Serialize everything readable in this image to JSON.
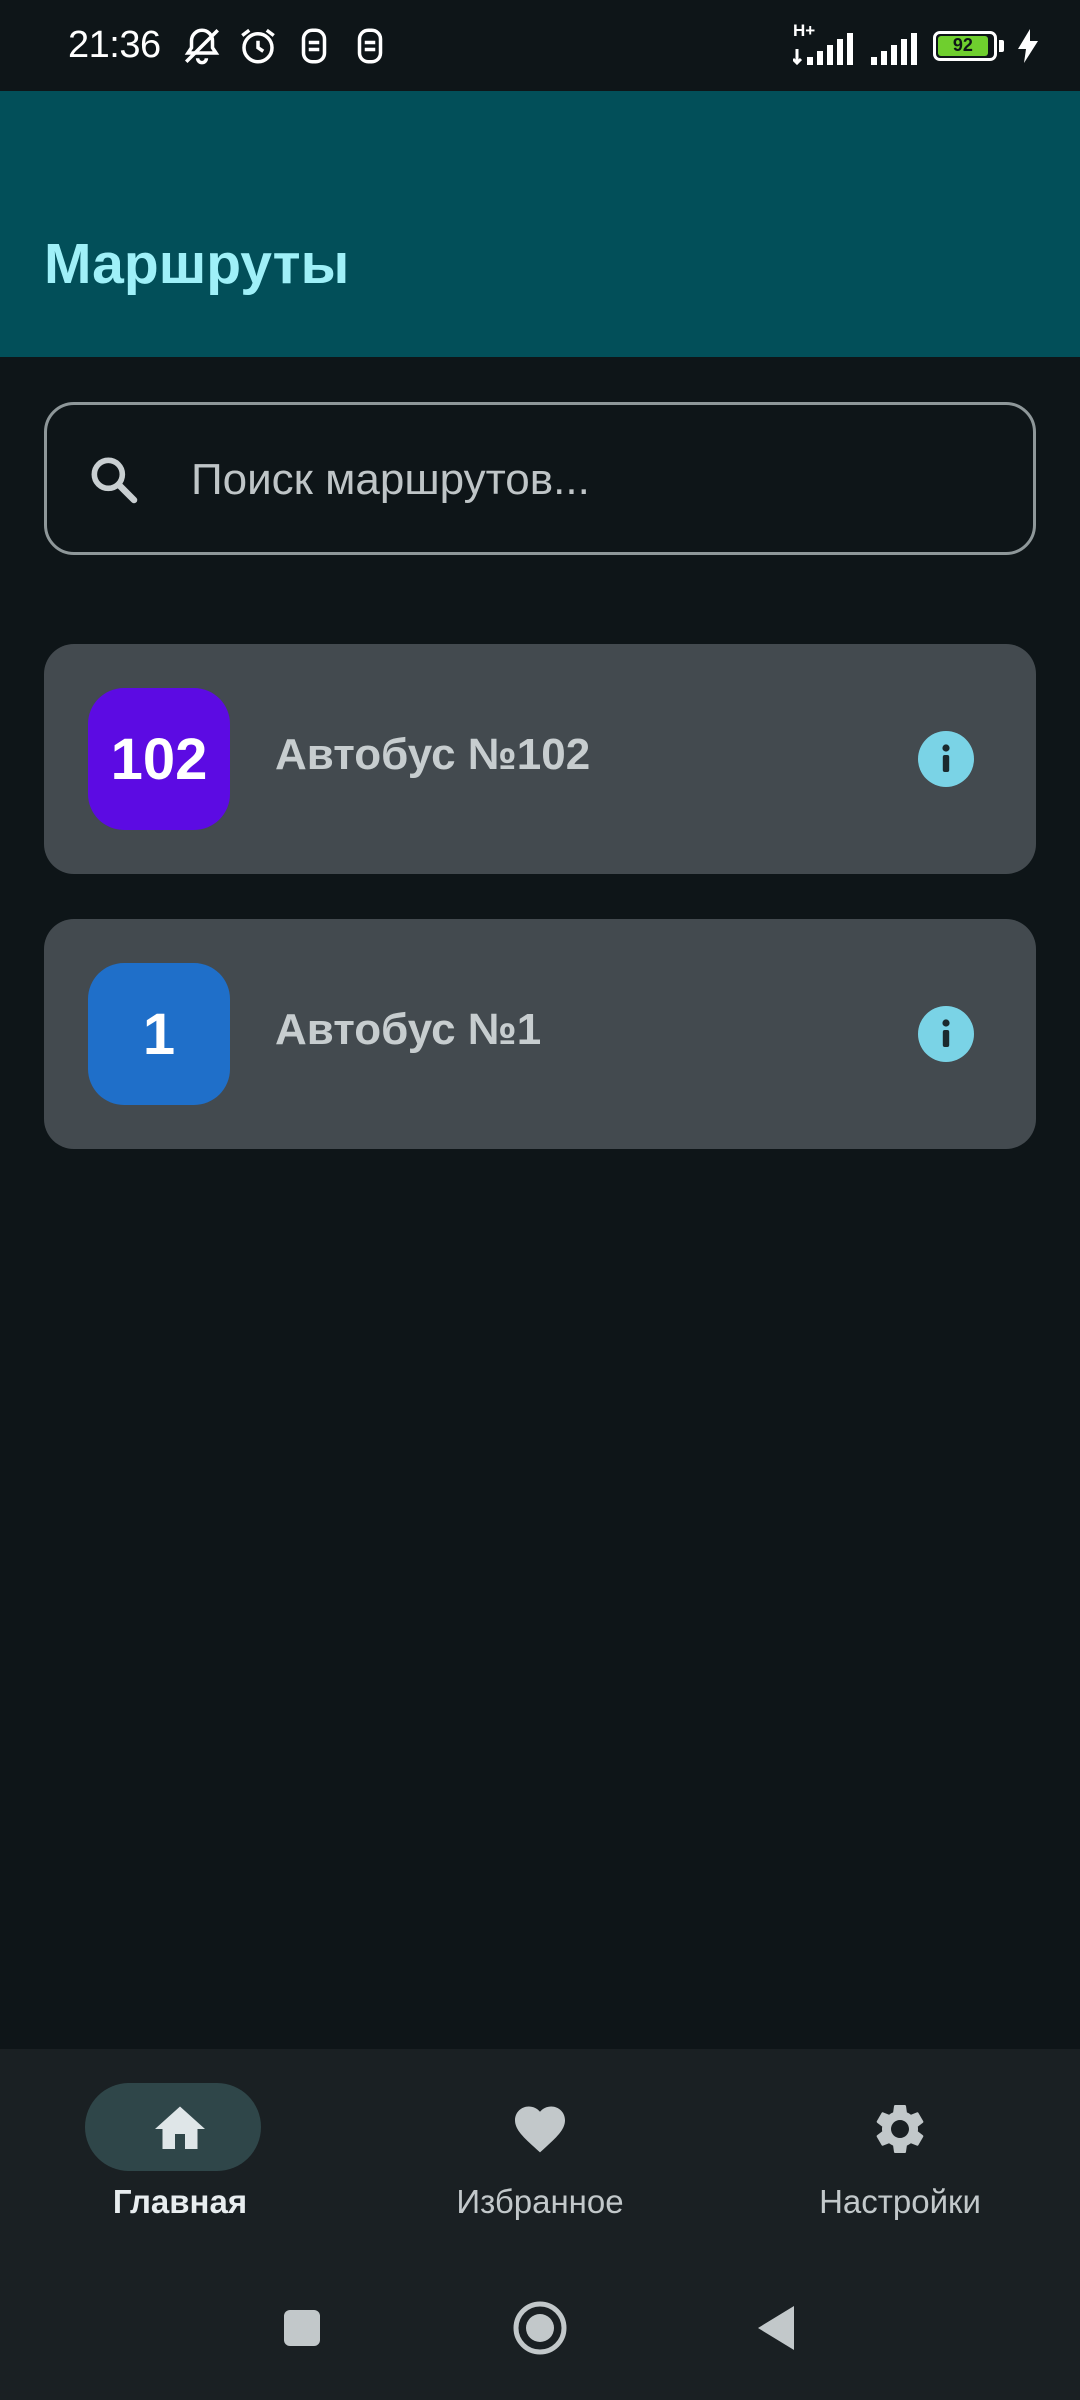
{
  "status_bar": {
    "time": "21:36",
    "network": "H+",
    "battery": "92",
    "icons": [
      "mute-icon",
      "alarm-icon",
      "notification-icon",
      "notification-icon",
      "signal-icon",
      "signal-icon",
      "battery-icon",
      "charging-icon"
    ]
  },
  "app_bar": {
    "title": "Маршруты"
  },
  "search": {
    "placeholder": "Поиск маршрутов...",
    "icon": "search-icon"
  },
  "routes": [
    {
      "number": "102",
      "name": "Автобус №102",
      "color": "#5c0be3"
    },
    {
      "number": "1",
      "name": "Автобус №1",
      "color": "#1f6fc9"
    }
  ],
  "bottom_nav": {
    "items": [
      {
        "label": "Главная",
        "icon": "home-icon",
        "active": true
      },
      {
        "label": "Избранное",
        "icon": "heart-icon",
        "active": false
      },
      {
        "label": "Настройки",
        "icon": "gear-icon",
        "active": false
      }
    ]
  },
  "colors": {
    "background": "#0e1518",
    "app_bar": "#024f59",
    "title": "#9ff0f8",
    "card": "#434a4f",
    "info": "#7ad3e6",
    "nav_bar": "#1a2023",
    "nav_indicator": "#2f4649"
  }
}
